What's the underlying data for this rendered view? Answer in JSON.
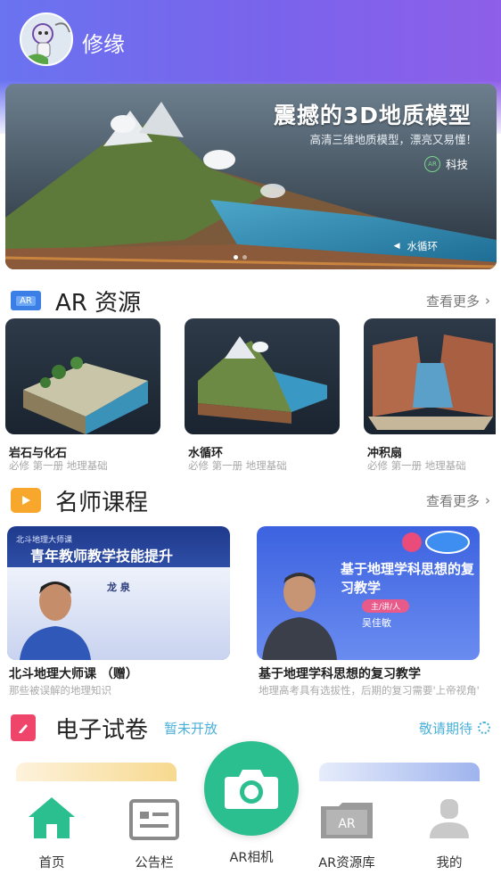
{
  "user": {
    "name": "修缘"
  },
  "banner": {
    "title": "震撼的3D地质模型",
    "subtitle": "高清三维地质模型，漂亮又易懂！",
    "brand": "科技",
    "brand_badge": "AR",
    "caption": "水循环",
    "dots": 2,
    "active_dot": 0
  },
  "ar_section": {
    "badge": "AR",
    "title": "AR 资源",
    "more": "查看更多",
    "items": [
      {
        "title": "岩石与化石",
        "sub": "必修 第一册 地理基础"
      },
      {
        "title": "水循环",
        "sub": "必修 第一册 地理基础"
      },
      {
        "title": "冲积扇",
        "sub": "必修 第一册 地理基础"
      }
    ]
  },
  "course_section": {
    "title": "名师课程",
    "more": "查看更多",
    "items": [
      {
        "banner_tag": "北斗地理大师课",
        "banner_headline": "青年教师教学技能提升",
        "speaker": "龙 泉",
        "title": "北斗地理大师课 （赠）",
        "sub": "那些被误解的地理知识"
      },
      {
        "banner_headline": "基于地理学科思想的复习教学",
        "speaker_tag": "主/讲/人",
        "speaker": "吴佳敏",
        "title": "基于地理学科思想的复习教学",
        "sub": "地理高考具有选拔性，后期的复习需要'上帝视角'"
      }
    ]
  },
  "exam_section": {
    "title": "电子试卷",
    "notice": "暂未开放",
    "right": "敬请期待"
  },
  "tabbar": {
    "home": "首页",
    "notice": "公告栏",
    "camera": "AR相机",
    "library": "AR资源库",
    "library_icon_text": "AR",
    "mine": "我的"
  },
  "colors": {
    "accent_green": "#2bbf8f",
    "header_start": "#6a73f0",
    "header_end": "#8e5fe8",
    "link_blue": "#4ab0d9"
  }
}
